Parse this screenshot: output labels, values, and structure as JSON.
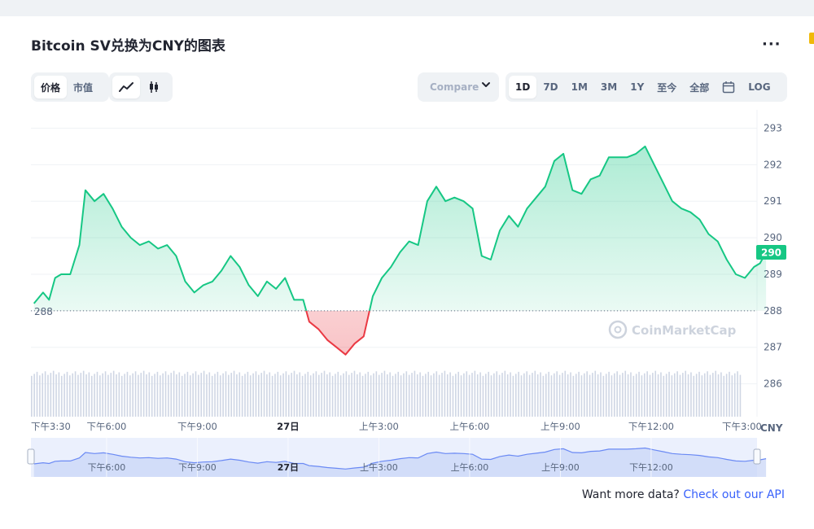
{
  "page": {
    "title": "Bitcoin SV兑换为CNY的图表"
  },
  "toolbar": {
    "metric_tabs": [
      {
        "label": "价格",
        "active": true
      },
      {
        "label": "市值",
        "active": false
      }
    ],
    "chart_style": [
      {
        "icon": "line-chart-icon",
        "active": true
      },
      {
        "icon": "candlestick-icon",
        "active": false
      }
    ],
    "compare_label": "Compare ",
    "ranges": [
      {
        "label": "1D",
        "active": true
      },
      {
        "label": "7D",
        "active": false
      },
      {
        "label": "1M",
        "active": false
      },
      {
        "label": "3M",
        "active": false
      },
      {
        "label": "1Y",
        "active": false
      },
      {
        "label": "至今",
        "active": false
      },
      {
        "label": "全部",
        "active": false
      }
    ],
    "calendar_icon": "calendar-icon",
    "log_label": "LOG"
  },
  "colors": {
    "up": "#16c784",
    "down": "#ea3943",
    "grid": "#eff2f5",
    "axis_text": "#58667e",
    "navigator": "#dde6fb",
    "accent": "#3861fb"
  },
  "watermark": "CoinMarketCap",
  "currency_label": "CNY",
  "footer": {
    "prompt": "Want more data? ",
    "link": "Check out our API"
  },
  "chart_data": {
    "type": "area",
    "title": "Bitcoin SV兑换为CNY的图表",
    "baseline": 288,
    "baseline_label": "288",
    "current_price_label": "290",
    "ylim": [
      285.1,
      293.5
    ],
    "y_ticks": [
      "286",
      "287",
      "288",
      "289",
      "290",
      "291",
      "292",
      "293"
    ],
    "x_range": [
      15.5,
      39.5
    ],
    "x_ticks": [
      {
        "x": 15.5,
        "label": "下午3:30",
        "bold": false
      },
      {
        "x": 18,
        "label": "下午6:00",
        "bold": false
      },
      {
        "x": 21,
        "label": "下午9:00",
        "bold": false
      },
      {
        "x": 24,
        "label": "27日",
        "bold": true
      },
      {
        "x": 27,
        "label": "上午3:00",
        "bold": false
      },
      {
        "x": 30,
        "label": "上午6:00",
        "bold": false
      },
      {
        "x": 33,
        "label": "上午9:00",
        "bold": false
      },
      {
        "x": 36,
        "label": "下午12:00",
        "bold": false
      },
      {
        "x": 39,
        "label": "下午3:00",
        "bold": false
      }
    ],
    "navigator_ticks": [
      {
        "x": 18,
        "label": "下午6:00",
        "bold": false
      },
      {
        "x": 21,
        "label": "下午9:00",
        "bold": false
      },
      {
        "x": 24,
        "label": "27日",
        "bold": true
      },
      {
        "x": 27,
        "label": "上午3:00",
        "bold": false
      },
      {
        "x": 30,
        "label": "上午6:00",
        "bold": false
      },
      {
        "x": 33,
        "label": "上午9:00",
        "bold": false
      },
      {
        "x": 36,
        "label": "下午12:00",
        "bold": false
      }
    ],
    "series": [
      {
        "values": [
          [
            15.6,
            288.2
          ],
          [
            15.9,
            288.5
          ],
          [
            16.1,
            288.3
          ],
          [
            16.3,
            288.9
          ],
          [
            16.5,
            289.0
          ],
          [
            16.8,
            289.0
          ],
          [
            17.1,
            289.8
          ],
          [
            17.3,
            291.3
          ],
          [
            17.6,
            291.0
          ],
          [
            17.9,
            291.2
          ],
          [
            18.2,
            290.8
          ],
          [
            18.5,
            290.3
          ],
          [
            18.8,
            290.0
          ],
          [
            19.1,
            289.8
          ],
          [
            19.4,
            289.9
          ],
          [
            19.7,
            289.7
          ],
          [
            20.0,
            289.8
          ],
          [
            20.3,
            289.5
          ],
          [
            20.6,
            288.8
          ],
          [
            20.9,
            288.5
          ],
          [
            21.2,
            288.7
          ],
          [
            21.5,
            288.8
          ],
          [
            21.8,
            289.1
          ],
          [
            22.1,
            289.5
          ],
          [
            22.4,
            289.2
          ],
          [
            22.7,
            288.7
          ],
          [
            23.0,
            288.4
          ],
          [
            23.3,
            288.8
          ],
          [
            23.6,
            288.6
          ],
          [
            23.9,
            288.9
          ],
          [
            24.2,
            288.3
          ],
          [
            24.5,
            288.3
          ],
          [
            24.7,
            287.7
          ],
          [
            25.0,
            287.5
          ],
          [
            25.3,
            287.2
          ],
          [
            25.6,
            287.0
          ],
          [
            25.9,
            286.8
          ],
          [
            26.2,
            287.1
          ],
          [
            26.5,
            287.3
          ],
          [
            26.8,
            288.4
          ],
          [
            27.1,
            288.9
          ],
          [
            27.4,
            289.2
          ],
          [
            27.7,
            289.6
          ],
          [
            28.0,
            289.9
          ],
          [
            28.3,
            289.8
          ],
          [
            28.6,
            291.0
          ],
          [
            28.9,
            291.4
          ],
          [
            29.2,
            291.0
          ],
          [
            29.5,
            291.1
          ],
          [
            29.8,
            291.0
          ],
          [
            30.1,
            290.8
          ],
          [
            30.4,
            289.5
          ],
          [
            30.7,
            289.4
          ],
          [
            31.0,
            290.2
          ],
          [
            31.3,
            290.6
          ],
          [
            31.6,
            290.3
          ],
          [
            31.9,
            290.8
          ],
          [
            32.2,
            291.1
          ],
          [
            32.5,
            291.4
          ],
          [
            32.8,
            292.1
          ],
          [
            33.1,
            292.3
          ],
          [
            33.4,
            291.3
          ],
          [
            33.7,
            291.2
          ],
          [
            34.0,
            291.6
          ],
          [
            34.3,
            291.7
          ],
          [
            34.6,
            292.2
          ],
          [
            34.9,
            292.2
          ],
          [
            35.2,
            292.2
          ],
          [
            35.5,
            292.3
          ],
          [
            35.8,
            292.5
          ],
          [
            36.1,
            292.0
          ],
          [
            36.4,
            291.5
          ],
          [
            36.7,
            291.0
          ],
          [
            37.0,
            290.8
          ],
          [
            37.3,
            290.7
          ],
          [
            37.6,
            290.5
          ],
          [
            37.9,
            290.1
          ],
          [
            38.2,
            289.9
          ],
          [
            38.5,
            289.4
          ],
          [
            38.8,
            289.0
          ],
          [
            39.1,
            288.9
          ],
          [
            39.4,
            289.2
          ],
          [
            39.6,
            289.3
          ],
          [
            39.8,
            289.6
          ]
        ]
      }
    ],
    "volume": {
      "note": "relative volume bars",
      "count": 260
    }
  }
}
